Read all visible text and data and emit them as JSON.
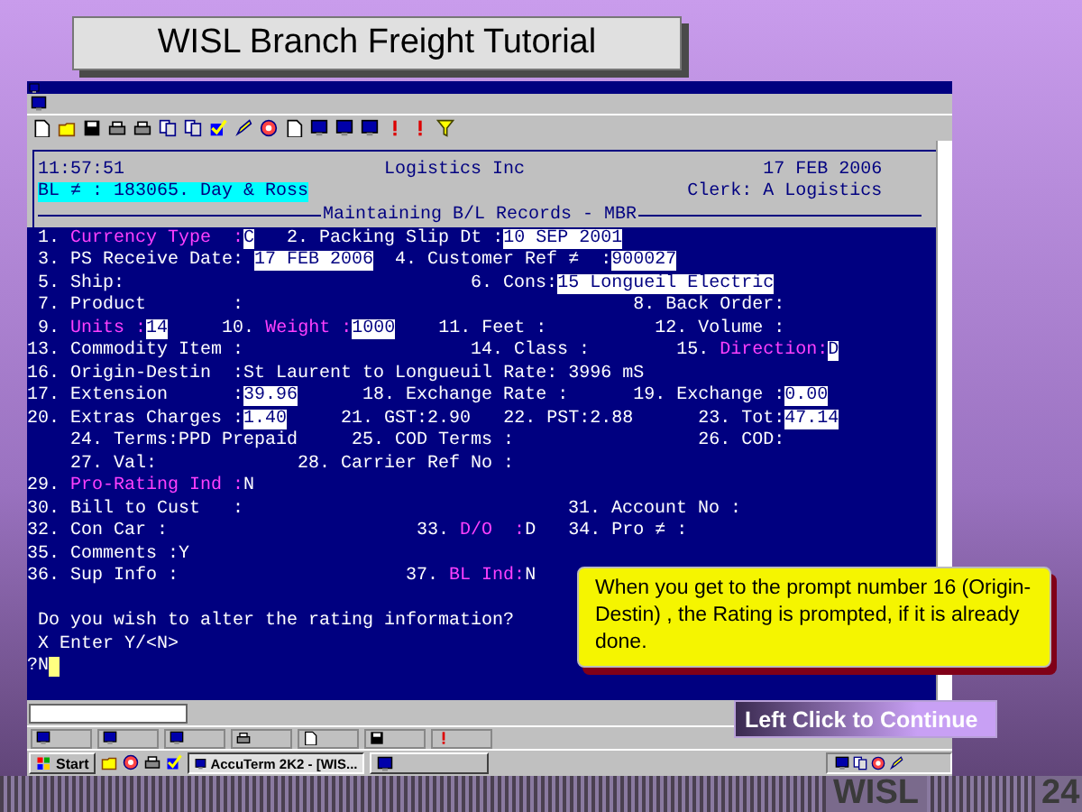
{
  "slide": {
    "title": "WISL Branch Freight Tutorial",
    "footer_label": "WISL",
    "page_number": "24"
  },
  "terminal": {
    "header": [
      {
        "segments": [
          {
            "text": "11:57:51",
            "kind": "text"
          },
          {
            "text": "Logistics Inc",
            "kind": "text"
          },
          {
            "text": "17 FEB 2006",
            "kind": "text"
          }
        ]
      },
      {
        "segments": [
          {
            "text": "BL ≠ : 183065. Day & Ross",
            "kind": "badge"
          },
          {
            "text": "Clerk: A Logistics",
            "kind": "text"
          }
        ]
      }
    ],
    "banner": "Maintaining B/L Records - MBR",
    "lines": [
      {
        "segments": [
          {
            "text": "1.",
            "kind": "label"
          },
          {
            "text": "Currency Type  :",
            "kind": "highlight"
          },
          {
            "text": "C",
            "kind": "value"
          },
          {
            "text": "2. Packing Slip Dt :",
            "kind": "label"
          },
          {
            "text": "10 SEP 2001",
            "kind": "value"
          }
        ]
      },
      {
        "segments": [
          {
            "text": "3. PS Receive Date:",
            "kind": "label"
          },
          {
            "text": "17 FEB 2006",
            "kind": "value"
          },
          {
            "text": "4. Customer Ref ≠  :",
            "kind": "label"
          },
          {
            "text": "900027",
            "kind": "value"
          }
        ]
      },
      {
        "segments": [
          {
            "text": "5. Ship:",
            "kind": "label"
          },
          {
            "text": "6. Cons:",
            "kind": "label"
          },
          {
            "text": "15 Longueil Electric",
            "kind": "value"
          }
        ]
      },
      {
        "segments": [
          {
            "text": "7. Product        :",
            "kind": "label"
          },
          {
            "text": "8. Back Order:",
            "kind": "label"
          }
        ]
      },
      {
        "segments": [
          {
            "text": "9.",
            "kind": "label"
          },
          {
            "text": "Units :",
            "kind": "highlight"
          },
          {
            "text": "14",
            "kind": "value"
          },
          {
            "text": "10.",
            "kind": "label"
          },
          {
            "text": "Weight :",
            "kind": "highlight"
          },
          {
            "text": "1000",
            "kind": "value"
          },
          {
            "text": "11. Feet :",
            "kind": "label"
          },
          {
            "text": "12. Volume :",
            "kind": "label"
          }
        ]
      },
      {
        "segments": [
          {
            "text": "13. Commodity Item :",
            "kind": "label"
          },
          {
            "text": "14. Class :",
            "kind": "label"
          },
          {
            "text": "15.",
            "kind": "label"
          },
          {
            "text": "Direction:",
            "kind": "highlight"
          },
          {
            "text": "D",
            "kind": "value"
          }
        ]
      },
      {
        "segments": [
          {
            "text": "16. Origin-Destin  :",
            "kind": "label"
          },
          {
            "text": "St Laurent to Longueuil",
            "kind": "label"
          },
          {
            "text": "Rate: 3996 mS",
            "kind": "label"
          }
        ]
      },
      {
        "segments": [
          {
            "text": "17. Extension      :",
            "kind": "label"
          },
          {
            "text": "39.96",
            "kind": "value"
          },
          {
            "text": "18. Exchange Rate :",
            "kind": "label"
          },
          {
            "text": "19. Exchange :",
            "kind": "label"
          },
          {
            "text": "0.00",
            "kind": "value"
          }
        ]
      },
      {
        "segments": [
          {
            "text": "20. Extras Charges :",
            "kind": "label"
          },
          {
            "text": "1.40",
            "kind": "value"
          },
          {
            "text": "21. GST:2.90",
            "kind": "label"
          },
          {
            "text": "22. PST:2.88",
            "kind": "label"
          },
          {
            "text": "23. Tot:",
            "kind": "label"
          },
          {
            "text": "47.14",
            "kind": "value"
          }
        ]
      },
      {
        "segments": [
          {
            "text": "24. Terms:PPD Prepaid",
            "kind": "label"
          },
          {
            "text": "25. COD Terms :",
            "kind": "label"
          },
          {
            "text": "26. COD:",
            "kind": "label"
          }
        ]
      },
      {
        "segments": [
          {
            "text": "27. Val:",
            "kind": "label"
          },
          {
            "text": "28. Carrier Ref No :",
            "kind": "label"
          }
        ]
      },
      {
        "segments": [
          {
            "text": "29.",
            "kind": "label"
          },
          {
            "text": "Pro-Rating Ind :",
            "kind": "highlight"
          },
          {
            "text": "N",
            "kind": "label"
          }
        ]
      },
      {
        "segments": [
          {
            "text": "30. Bill to Cust   :",
            "kind": "label"
          },
          {
            "text": "31. Account No :",
            "kind": "label"
          }
        ]
      },
      {
        "segments": [
          {
            "text": "32. Con Car :",
            "kind": "label"
          },
          {
            "text": "33.",
            "kind": "label"
          },
          {
            "text": "D/O  :",
            "kind": "highlight"
          },
          {
            "text": "D",
            "kind": "label"
          },
          {
            "text": "34. Pro ≠ :",
            "kind": "label"
          }
        ]
      },
      {
        "segments": [
          {
            "text": "35. Comments :Y",
            "kind": "label"
          }
        ]
      },
      {
        "segments": [
          {
            "text": "36. Sup Info :",
            "kind": "label"
          },
          {
            "text": "37.",
            "kind": "label"
          },
          {
            "text": "BL Ind:",
            "kind": "highlight"
          },
          {
            "text": "N",
            "kind": "label"
          }
        ]
      }
    ],
    "prompt": [
      "Do you wish to alter the rating information?",
      "X Enter Y/<N>",
      "?N"
    ]
  },
  "callout": {
    "text": "When you get to the prompt number 16 (Origin-Destin) , the Rating is prompted, if it is already done."
  },
  "continue_button": {
    "label": "Left Click to Continue"
  },
  "taskbar": {
    "start": "Start",
    "task": "AccuTerm 2K2 - [WIS..."
  }
}
